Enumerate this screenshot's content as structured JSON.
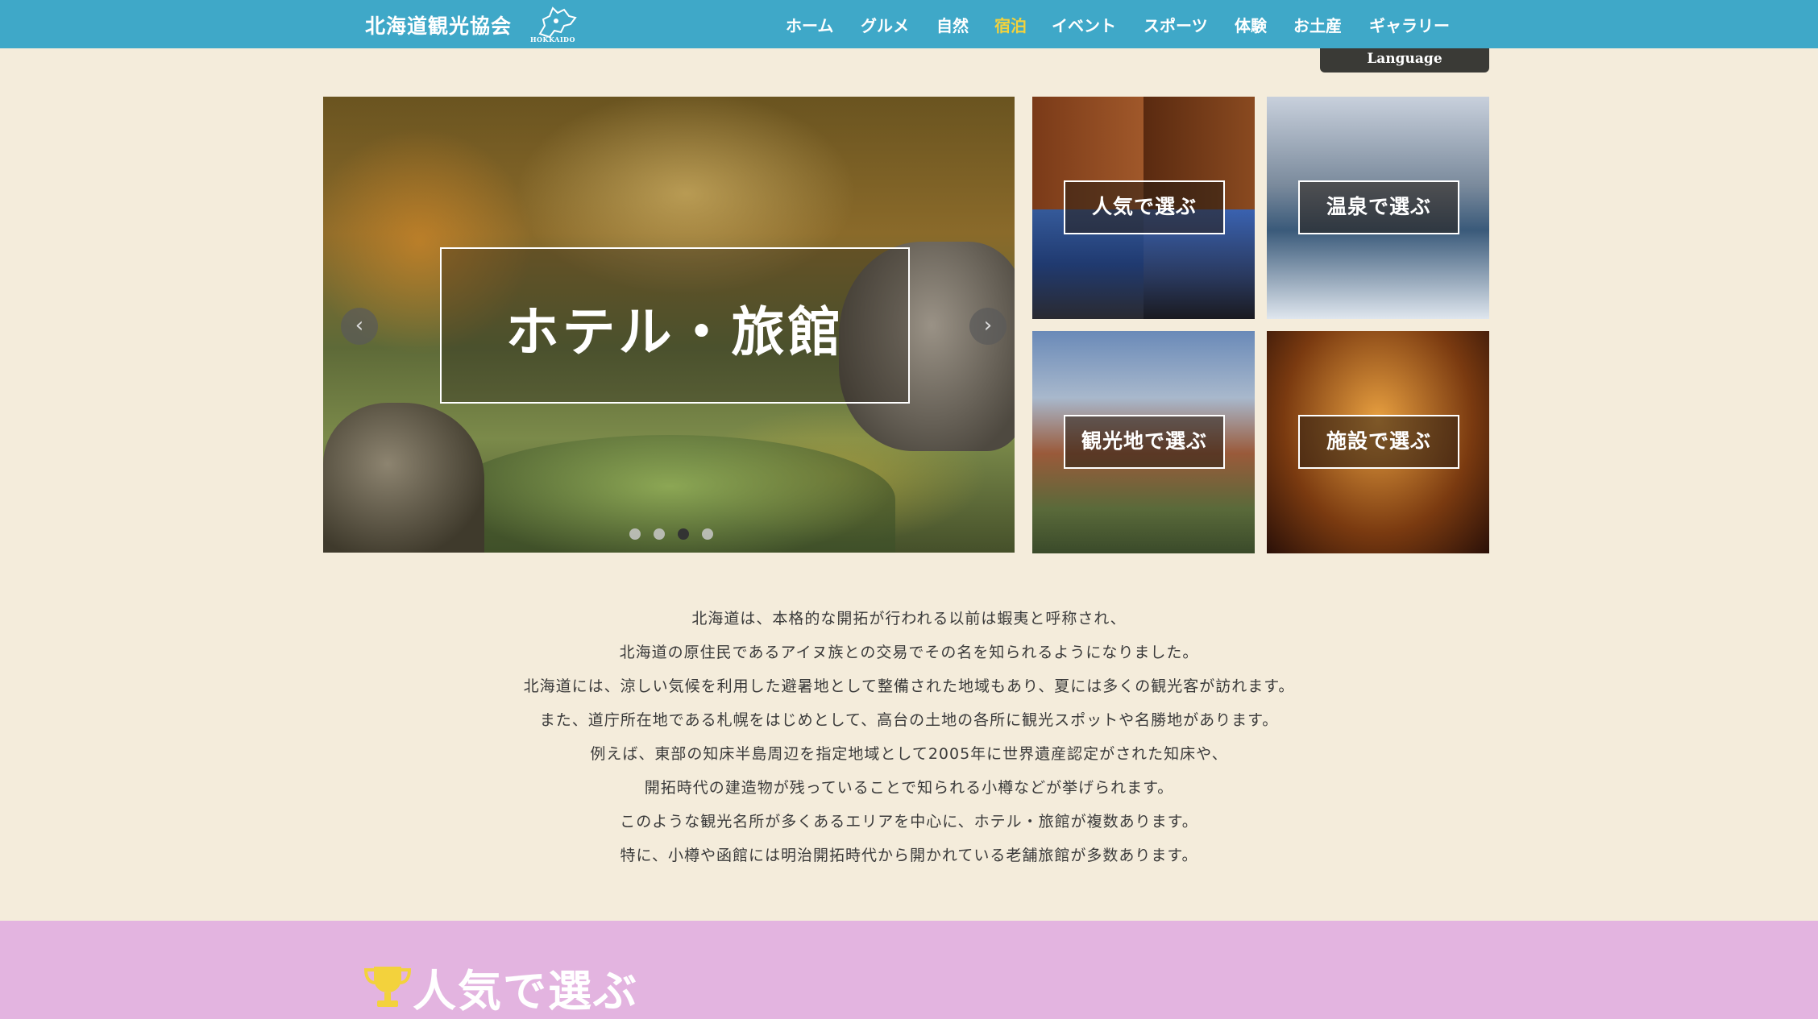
{
  "header": {
    "site_title": "北海道観光協会",
    "logo_text": "HOKKAIDO",
    "nav": [
      {
        "label": "ホーム",
        "active": false
      },
      {
        "label": "グルメ",
        "active": false
      },
      {
        "label": "自然",
        "active": false
      },
      {
        "label": "宿泊",
        "active": true
      },
      {
        "label": "イベント",
        "active": false
      },
      {
        "label": "スポーツ",
        "active": false
      },
      {
        "label": "体験",
        "active": false
      },
      {
        "label": "お土産",
        "active": false
      },
      {
        "label": "ギャラリー",
        "active": false
      }
    ],
    "language_label": "Language",
    "colors": {
      "bar": "#3fa8c8",
      "active": "#f3d23c"
    }
  },
  "hero": {
    "caption": "ホテル・旅館",
    "prev_icon": "‹",
    "next_icon": "›",
    "slide_count": 4,
    "active_slide": 3
  },
  "tiles": [
    {
      "label": "人気で選ぶ"
    },
    {
      "label": "温泉で選ぶ"
    },
    {
      "label": "観光地で選ぶ"
    },
    {
      "label": "施設で選ぶ"
    }
  ],
  "intro": {
    "lines": [
      "北海道は、本格的な開拓が行われる以前は蝦夷と呼称され、",
      "北海道の原住民であるアイヌ族との交易でその名を知られるようになりました。",
      "北海道には、涼しい気候を利用した避暑地として整備された地域もあり、夏には多くの観光客が訪れます。",
      "また、道庁所在地である札幌をはじめとして、高台の土地の各所に観光スポットや名勝地があります。",
      "例えば、東部の知床半島周辺を指定地域として2005年に世界遺産認定がされた知床や、",
      "開拓時代の建造物が残っていることで知られる小樽などが挙げられます。",
      "このような観光名所が多くあるエリアを中心に、ホテル・旅館が複数あります。",
      "特に、小樽や函館には明治開拓時代から開かれている老舗旅館が多数あります。"
    ]
  },
  "ranking": {
    "title": "人気で選ぶ",
    "band_color": "#e3b4e0",
    "trophy_color": "#f3d23c"
  }
}
